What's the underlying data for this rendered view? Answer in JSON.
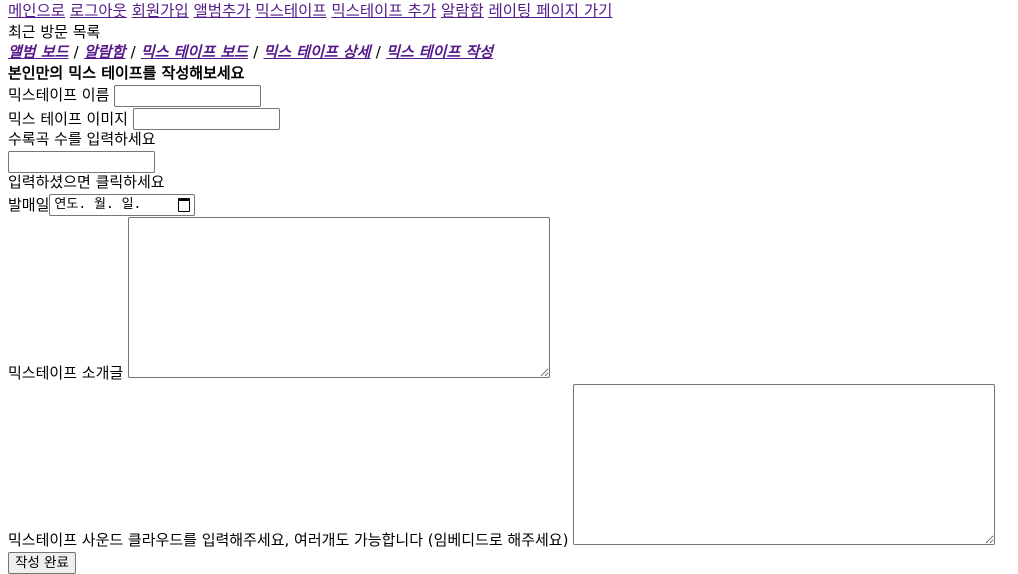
{
  "nav": {
    "main": "메인으로",
    "logout": "로그아웃",
    "signup": "회원가입",
    "add_album": "앨범추가",
    "mixtape": "믹스테이프",
    "add_mixtape": "믹스테이프 추가",
    "album_shelf": "알람함",
    "rating_page": "레이팅 페이지 가기"
  },
  "recent": {
    "title": "최근 방문 목록",
    "items": [
      "앨범 보드",
      "알람함",
      "믹스 테이프 보드",
      "믹스 테이프 상세",
      "믹스 테이프 작성"
    ],
    "separator": "/"
  },
  "form": {
    "heading": "본인만의 믹스 테이프를 작성해보세요",
    "name_label": "믹스테이프 이름",
    "name_value": "",
    "image_label": "믹스 테이프 이미지",
    "image_value": "",
    "tracks_label": "수록곡 수를 입력하세요",
    "tracks_value": "",
    "tracks_hint": "입력하셨으면 클릭하세요",
    "release_label": "발매일",
    "release_placeholder": "연도. 월. 일.",
    "intro_label": "믹스테이프 소개글",
    "intro_value": "",
    "sound_label": "믹스테이프 사운드 클라우드를 입력해주세요, 여러개도 가능합니다 (임베디드로 해주세요)",
    "sound_value": "",
    "submit": "작성 완료"
  },
  "icons": {
    "calendar": "calendar-icon"
  },
  "colors": {
    "link": "#551a8b",
    "text": "#000000",
    "button_bg": "#efefef",
    "field_border": "#767676"
  }
}
